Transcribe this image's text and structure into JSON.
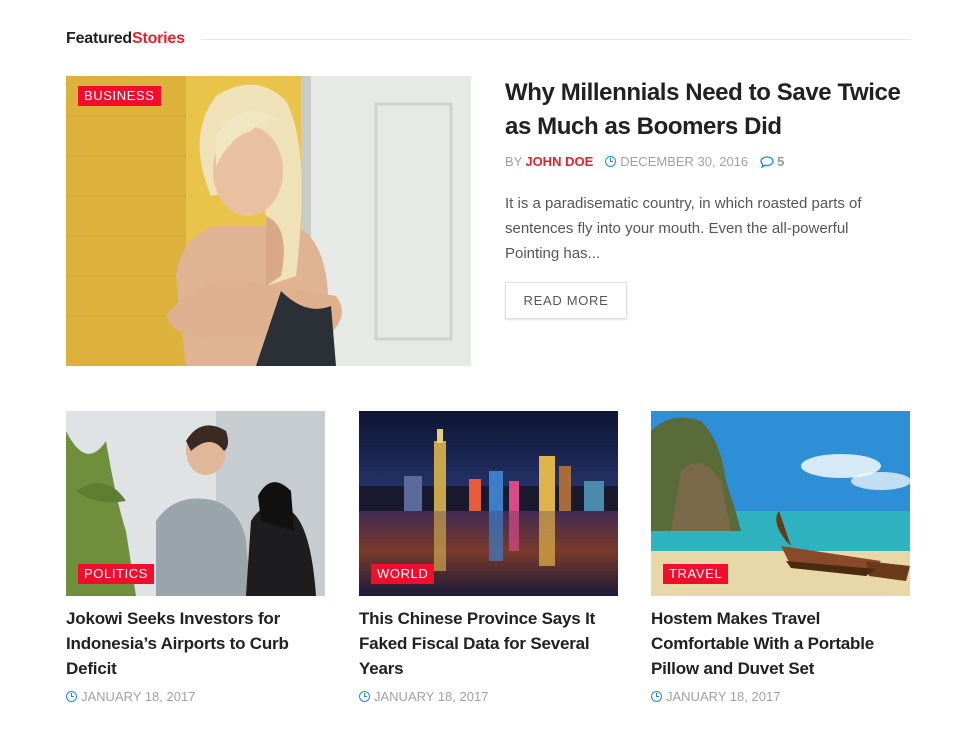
{
  "section": {
    "title_part1": "Featured",
    "title_part2": "Stories"
  },
  "featured": {
    "category": "BUSINESS",
    "title": "Why Millennials Need to Save Twice as Much as Boomers Did",
    "by": "BY",
    "author": "JOHN DOE",
    "date": "DECEMBER 30, 2016",
    "comments": "5",
    "excerpt": "It is a paradisematic country, in which roasted parts of sentences fly into your mouth. Even the all-powerful Pointing has...",
    "read_more": "READ MORE"
  },
  "cards": [
    {
      "category": "POLITICS",
      "title": "Jokowi Seeks Investors for Indonesia’s Airports to Curb Deficit",
      "date": "JANUARY 18, 2017"
    },
    {
      "category": "WORLD",
      "title": "This Chinese Province Says It Faked Fiscal Data for Several Years",
      "date": "JANUARY 18, 2017"
    },
    {
      "category": "TRAVEL",
      "title": "Hostem Makes Travel Comfortable With a Portable Pillow and Duvet Set",
      "date": "JANUARY 18, 2017"
    }
  ],
  "colors": {
    "accent": "#e8202c",
    "badge": "#f20d2c",
    "icon_blue": "#1e88e5"
  },
  "icons": {
    "date": "clock-icon",
    "comments": "comment-icon"
  }
}
